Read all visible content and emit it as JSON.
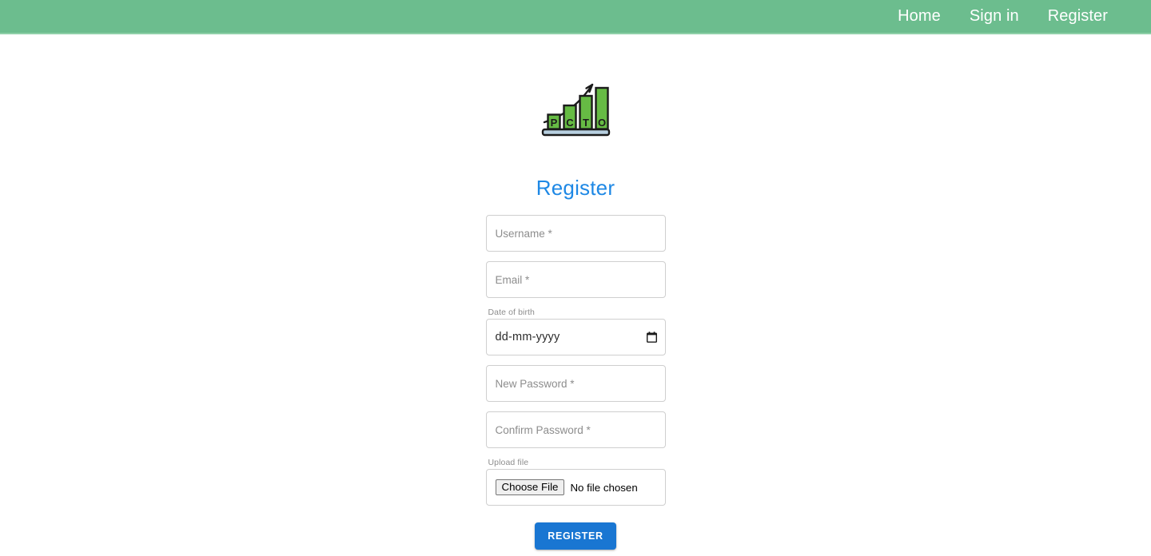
{
  "navbar": {
    "background_color": "#6cbd8e",
    "links": [
      {
        "label": "Home",
        "name": "nav-link-home"
      },
      {
        "label": "Sign in",
        "name": "nav-link-sign-in"
      },
      {
        "label": "Register",
        "name": "nav-link-register"
      }
    ]
  },
  "logo": {
    "alt": "PCTO bar chart growth logo",
    "letters": [
      "P",
      "C",
      "T",
      "O"
    ],
    "bar_color": "#66bb44",
    "outline_color": "#1b1b1b",
    "base_color": "#b7cfe0"
  },
  "main": {
    "title": "Register",
    "title_color": "#1e88e5"
  },
  "form": {
    "username": {
      "placeholder": "Username *",
      "value": ""
    },
    "email": {
      "placeholder": "Email *",
      "value": ""
    },
    "date_of_birth": {
      "label": "Date of birth",
      "placeholder": "dd-mm-yyyy",
      "value": ""
    },
    "new_password": {
      "placeholder": "New Password *",
      "value": ""
    },
    "confirm_password": {
      "placeholder": "Confirm Password *",
      "value": ""
    },
    "upload_file": {
      "label": "Upload file",
      "button_label": "Choose File",
      "status_text": "No file chosen"
    },
    "submit": {
      "label": "REGISTER",
      "color": "#1976d2"
    }
  }
}
